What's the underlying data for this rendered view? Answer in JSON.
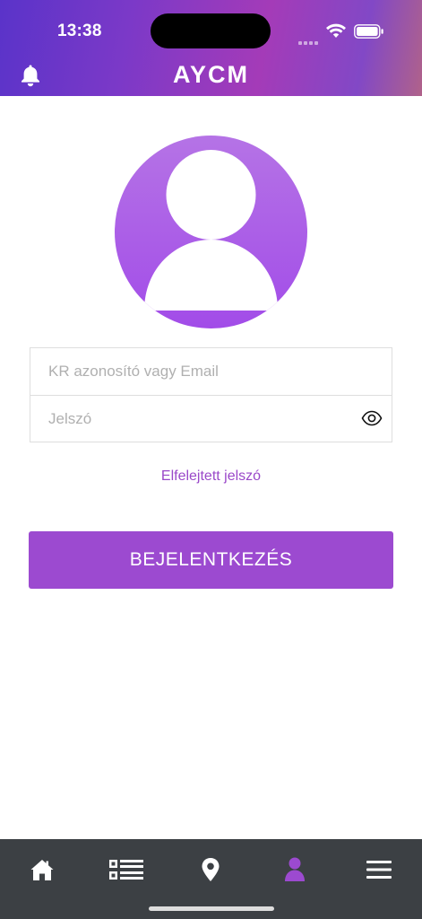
{
  "status_bar": {
    "time": "13:38"
  },
  "header": {
    "logo": "AYCM",
    "bell_icon": "bell-icon"
  },
  "login": {
    "username_placeholder": "KR azonosító vagy Email",
    "password_placeholder": "Jelszó",
    "forgot_password": "Elfelejtett jelszó",
    "submit_label": "BEJELENTKEZÉS"
  },
  "tab_bar": {
    "items": [
      {
        "icon": "home-icon",
        "active": false
      },
      {
        "icon": "list-icon",
        "active": false
      },
      {
        "icon": "map-pin-icon",
        "active": false
      },
      {
        "icon": "user-icon",
        "active": true
      },
      {
        "icon": "menu-icon",
        "active": false
      }
    ]
  },
  "colors": {
    "accent": "#9c4ad0",
    "tab_bar_bg": "#3c4044",
    "active_tab": "#9c4ad0",
    "inactive_tab": "#ffffff"
  }
}
